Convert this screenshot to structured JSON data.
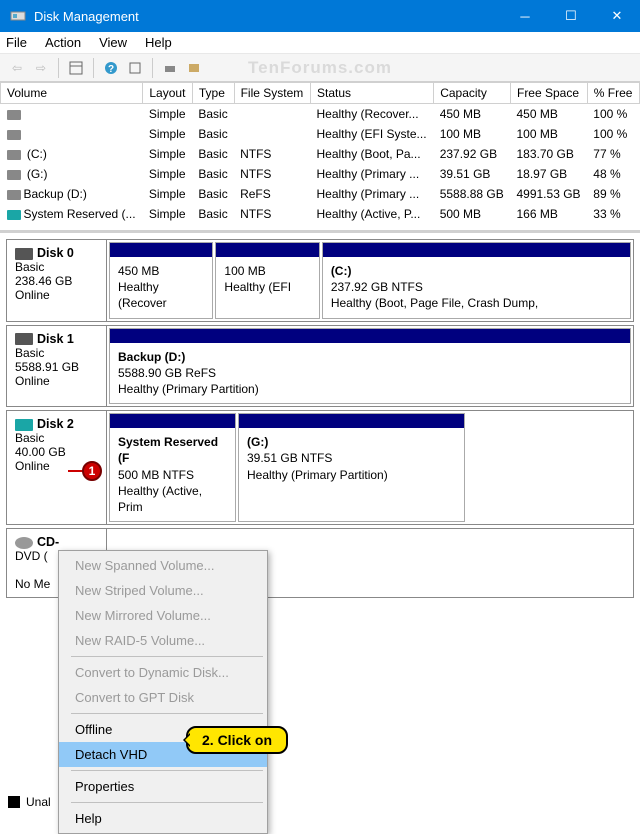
{
  "window": {
    "title": "Disk Management"
  },
  "menubar": [
    "File",
    "Action",
    "View",
    "Help"
  ],
  "watermark": "TenForums.com",
  "columns": [
    "Volume",
    "Layout",
    "Type",
    "File System",
    "Status",
    "Capacity",
    "Free Space",
    "% Free"
  ],
  "volumes": [
    {
      "name": "",
      "icon": "gray",
      "layout": "Simple",
      "vtype": "Basic",
      "fs": "",
      "status": "Healthy (Recover...",
      "cap": "450 MB",
      "free": "450 MB",
      "pct": "100 %"
    },
    {
      "name": "",
      "icon": "gray",
      "layout": "Simple",
      "vtype": "Basic",
      "fs": "",
      "status": "Healthy (EFI Syste...",
      "cap": "100 MB",
      "free": "100 MB",
      "pct": "100 %"
    },
    {
      "name": " (C:)",
      "icon": "gray",
      "layout": "Simple",
      "vtype": "Basic",
      "fs": "NTFS",
      "status": "Healthy (Boot, Pa...",
      "cap": "237.92 GB",
      "free": "183.70 GB",
      "pct": "77 %"
    },
    {
      "name": " (G:)",
      "icon": "gray",
      "layout": "Simple",
      "vtype": "Basic",
      "fs": "NTFS",
      "status": "Healthy (Primary ...",
      "cap": "39.51 GB",
      "free": "18.97 GB",
      "pct": "48 %"
    },
    {
      "name": "Backup (D:)",
      "icon": "gray",
      "layout": "Simple",
      "vtype": "Basic",
      "fs": "ReFS",
      "status": "Healthy (Primary ...",
      "cap": "5588.88 GB",
      "free": "4991.53 GB",
      "pct": "89 %"
    },
    {
      "name": "System Reserved (...",
      "icon": "teal",
      "layout": "Simple",
      "vtype": "Basic",
      "fs": "NTFS",
      "status": "Healthy (Active, P...",
      "cap": "500 MB",
      "free": "166 MB",
      "pct": "33 %"
    }
  ],
  "disks": [
    {
      "title": "Disk 0",
      "icon": "gray",
      "type": "Basic",
      "size": "238.46 GB",
      "state": "Online",
      "parts": [
        {
          "l1": "",
          "l2": "450 MB",
          "l3": "Healthy (Recover",
          "flex": "1"
        },
        {
          "l1": "",
          "l2": "100 MB",
          "l3": "Healthy (EFI",
          "flex": "1"
        },
        {
          "l1": "(C:)",
          "l2": "237.92 GB NTFS",
          "l3": "Healthy (Boot, Page File, Crash Dump,",
          "flex": "3"
        }
      ]
    },
    {
      "title": "Disk 1",
      "icon": "gray",
      "type": "Basic",
      "size": "5588.91 GB",
      "state": "Online",
      "parts": [
        {
          "l1": "Backup  (D:)",
          "l2": "5588.90 GB ReFS",
          "l3": "Healthy (Primary Partition)",
          "flex": "1"
        }
      ]
    },
    {
      "title": "Disk 2",
      "icon": "teal",
      "type": "Basic",
      "size": "40.00 GB",
      "state": "Online",
      "parts": [
        {
          "l1": "System Reserved  (F",
          "l2": "500 MB NTFS",
          "l3": "Healthy (Active, Prim",
          "flex": "1"
        },
        {
          "l1": "(G:)",
          "l2": "39.51 GB NTFS",
          "l3": "Healthy (Primary Partition)",
          "flex": "1.8"
        }
      ]
    }
  ],
  "cdrom": {
    "title": "CD-",
    "type": "DVD (",
    "msg": "No Me"
  },
  "ctxmenu": [
    {
      "label": "New Spanned Volume...",
      "state": "disabled"
    },
    {
      "label": "New Striped Volume...",
      "state": "disabled"
    },
    {
      "label": "New Mirrored Volume...",
      "state": "disabled"
    },
    {
      "label": "New RAID-5 Volume...",
      "state": "disabled"
    },
    {
      "sep": true
    },
    {
      "label": "Convert to Dynamic Disk...",
      "state": "disabled"
    },
    {
      "label": "Convert to GPT Disk",
      "state": "disabled"
    },
    {
      "sep": true
    },
    {
      "label": "Offline",
      "state": ""
    },
    {
      "label": "Detach VHD",
      "state": "highlight"
    },
    {
      "sep": true
    },
    {
      "label": "Properties",
      "state": ""
    },
    {
      "sep": true
    },
    {
      "label": "Help",
      "state": ""
    }
  ],
  "annotations": {
    "step1": "1",
    "step2": "2. Click on"
  },
  "legend": {
    "unallocated": "Unal"
  }
}
